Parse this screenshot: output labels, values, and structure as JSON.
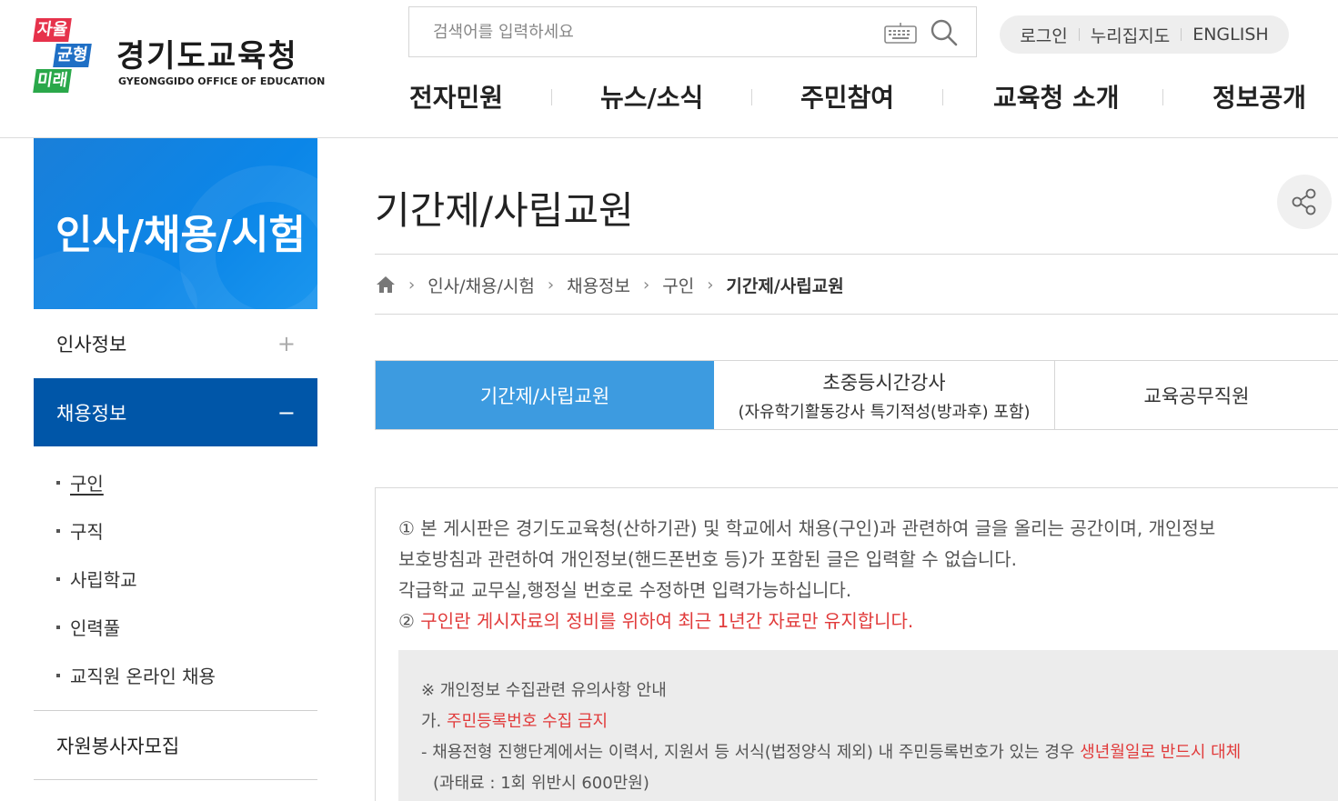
{
  "header": {
    "logo": {
      "mark_lines": [
        "자율",
        "균형",
        "미래"
      ],
      "title": "경기도교육청",
      "subtitle": "GYEONGGIDO OFFICE OF EDUCATION"
    },
    "search": {
      "placeholder": "검색어를 입력하세요"
    },
    "util": {
      "login": "로그인",
      "sitemap": "누리집지도",
      "english": "ENGLISH"
    },
    "gnb": [
      "전자민원",
      "뉴스/소식",
      "주민참여",
      "교육청 소개",
      "정보공개"
    ]
  },
  "sidebar": {
    "title": "인사/채용/시험",
    "items": [
      {
        "label": "인사정보",
        "toggle": "+"
      },
      {
        "label": "채용정보",
        "toggle": "−"
      }
    ],
    "sub_items": [
      "구인",
      "구직",
      "사립학교",
      "인력풀",
      "교직원 온라인 채용"
    ],
    "extra": "자원봉사자모집"
  },
  "content": {
    "title": "기간제/사립교원",
    "breadcrumb": [
      "인사/채용/시험",
      "채용정보",
      "구인",
      "기간제/사립교원"
    ],
    "tabs": [
      {
        "label": "기간제/사립교원",
        "sub": ""
      },
      {
        "label": "초중등시간강사",
        "sub": "(자유학기활동강사 특기적성(방과후) 포함)"
      },
      {
        "label": "교육공무직원",
        "sub": ""
      }
    ],
    "notice": {
      "line1": "① 본 게시판은 경기도교육청(산하기관) 및 학교에서 채용(구인)과 관련하여 글을 올리는 공간이며, 개인정보",
      "line2": "보호방침과 관련하여 개인정보(핸드폰번호 등)가 포함된 글은 입력할 수 없습니다.",
      "line3": "각급학교 교무실,행정실 번호로 수정하면 입력가능하십니다.",
      "line4_prefix": "② ",
      "line4_red": "구인란 게시자료의 정비를 위하여 최근 1년간 자료만 유지합니다.",
      "box": {
        "heading": "※ 개인정보 수집관련 유의사항 안내",
        "item_a_prefix": "가. ",
        "item_a_red": "주민등록번호 수집 금지",
        "item_a_detail_prefix": "- 채용전형 진행단계에서는 이력서, 지원서 등 서식(법정양식 제외) 내 주민등록번호가 있는 경우 ",
        "item_a_detail_red": "생년월일로 반드시 대체",
        "penalty": "(과태료 : 1회 위반시 600만원)"
      }
    }
  },
  "colors": {
    "sidebar_active": "#0056a8",
    "sidebar_head": "#0b86e8",
    "tab_active": "#3d9be0",
    "warning_red": "#e13b3b"
  }
}
